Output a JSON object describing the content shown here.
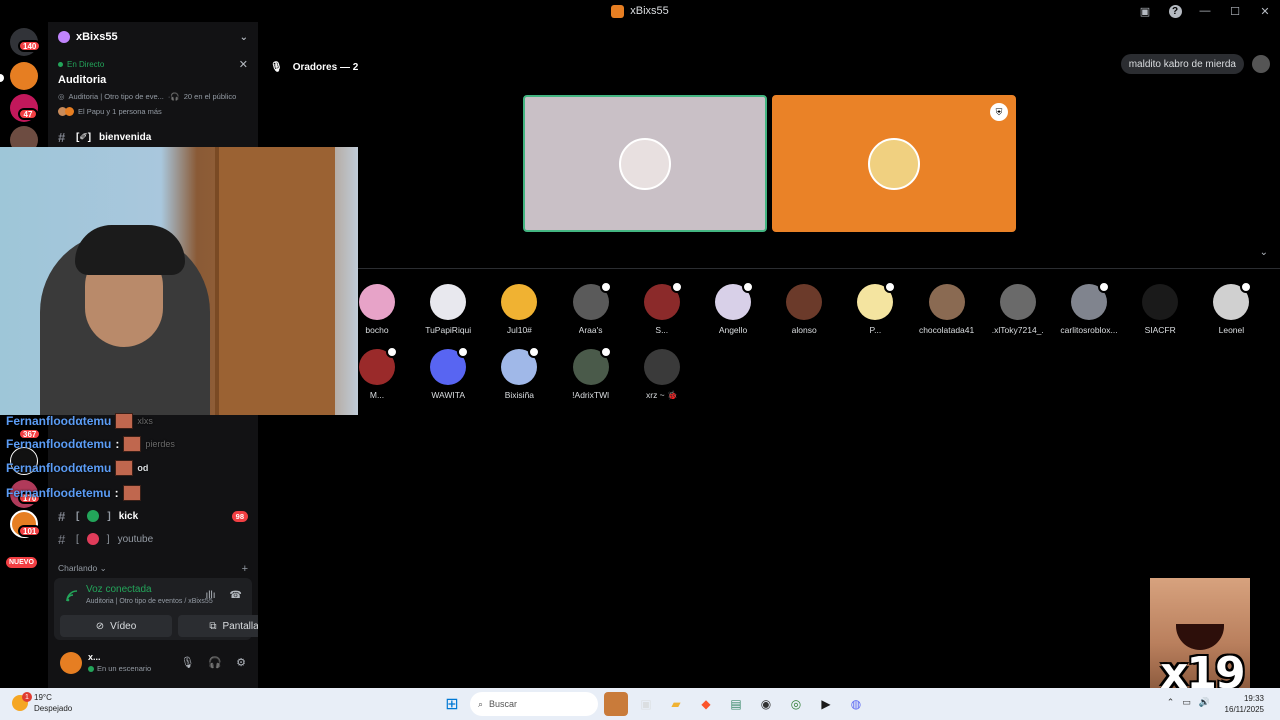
{
  "window": {
    "title": "xBixs55"
  },
  "rail": {
    "badges": [
      "140",
      "47",
      "367",
      "170",
      "101"
    ],
    "new_label": "NUEVO"
  },
  "server": {
    "name": "xBixs55"
  },
  "live": {
    "status": "En Directo",
    "title": "Auditoria",
    "meta": "Auditoria | Otro tipo de eve...",
    "listeners": "20 en el público",
    "users": "El Papu y 1 persona más"
  },
  "channels": [
    {
      "label": "bienvenida",
      "prefix": "[✐]"
    },
    {
      "label": "kick",
      "count": "98",
      "color": "#23a55a"
    },
    {
      "label": "youtube",
      "color": "#e03c5a"
    }
  ],
  "category": {
    "label": "Charlando ⌄"
  },
  "overlay_chat": [
    {
      "user": "Fernanfloodαtemu",
      "behind": "xlxs"
    },
    {
      "user": "Fernanfloodαtemu",
      "behind": "pierdes"
    },
    {
      "user": "Fernanfloodαtemu",
      "behind": "od"
    },
    {
      "user": "Fernanfloodetemu",
      "behind": ""
    }
  ],
  "voice": {
    "status": "Voz conectada",
    "sub": "Auditoria | Otro tipo de eventos / xBixs55",
    "video_label": "Vídeo",
    "screen_label": "Pantalla"
  },
  "user": {
    "name": "x...",
    "status": "En un escenario"
  },
  "stage": {
    "speakers_label": "Oradores — 2",
    "chat_pill": "maldito kabro de mierda"
  },
  "speakers": [
    {
      "bg": "#c9c0c6",
      "border": "#43b581",
      "avatar": "#e8e0e0",
      "mod": false
    },
    {
      "bg": "#ea8227",
      "border": "#ea8227",
      "avatar": "#f0d080",
      "mod": true
    }
  ],
  "audience": [
    {
      "name": "bocho",
      "color": "#e7a3c8",
      "mod": false
    },
    {
      "name": "TuPapiRiqui",
      "color": "#e8e8ee",
      "mod": false
    },
    {
      "name": "Jul10#",
      "color": "#f0b232",
      "mod": false
    },
    {
      "name": "Araa's",
      "color": "#5a5a5a",
      "mod": true
    },
    {
      "name": "S...",
      "color": "#8b2a2a",
      "mod": true
    },
    {
      "name": "Angello",
      "color": "#d8d0e8",
      "mod": true
    },
    {
      "name": "alonso",
      "color": "#6b3a2a",
      "mod": false
    },
    {
      "name": "P...",
      "color": "#f4e4a0",
      "mod": true
    },
    {
      "name": "chocolatada41",
      "color": "#8a6a52",
      "mod": false
    },
    {
      "name": ".xlToky7214_.",
      "color": "#6a6a6a",
      "mod": false
    },
    {
      "name": "carlitosroblox...",
      "color": "#80848e",
      "mod": true
    },
    {
      "name": "SIACFR",
      "color": "#1a1a1a",
      "mod": false
    },
    {
      "name": "Leonel",
      "color": "#d0d0d0",
      "mod": true
    },
    {
      "name": "M...",
      "color": "#9a2a2a",
      "mod": true
    },
    {
      "name": "WAWITA",
      "color": "#5865f2",
      "mod": true
    },
    {
      "name": "Bixisiña",
      "color": "#a0b8e8",
      "mod": true
    },
    {
      "name": "!AdrixTWl",
      "color": "#4a5a4a",
      "mod": true
    },
    {
      "name": "xrz ~ 🐞",
      "color": "#3a3a3a",
      "mod": false
    }
  ],
  "emote": {
    "multiplier": "x19"
  },
  "taskbar": {
    "temp": "19°C",
    "weather": "Despejado",
    "weather_badge": "1",
    "search_placeholder": "Buscar",
    "time": "19:33",
    "date": "16/11/2025"
  }
}
